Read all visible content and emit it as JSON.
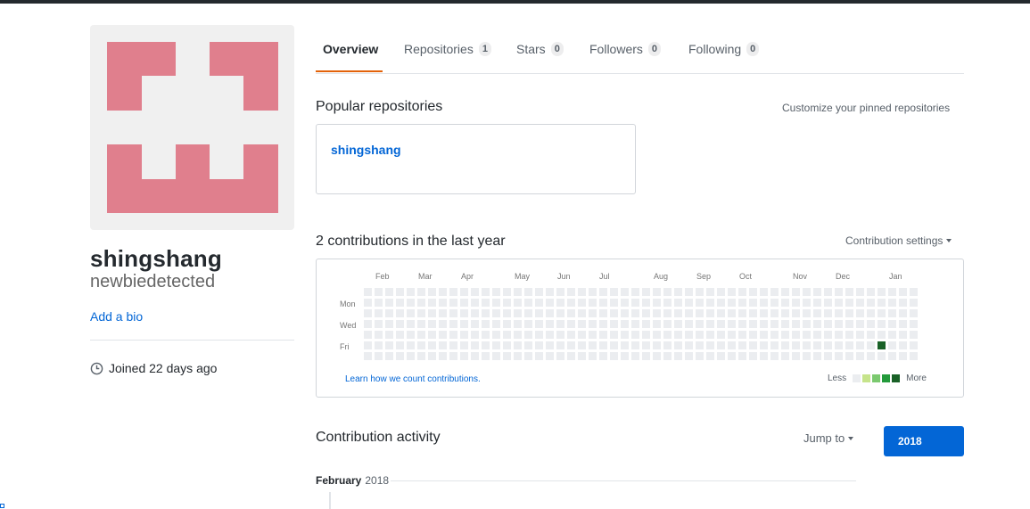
{
  "profile": {
    "full_name": "shingshang",
    "username": "newbiedetected",
    "add_bio": "Add a bio",
    "joined": "Joined 22 days ago",
    "avatar_color": "#e07f8d",
    "avatar_bg": "#f0f0f0"
  },
  "tabs": [
    {
      "label": "Overview",
      "count": null,
      "active": true
    },
    {
      "label": "Repositories",
      "count": "1",
      "active": false
    },
    {
      "label": "Stars",
      "count": "0",
      "active": false
    },
    {
      "label": "Followers",
      "count": "0",
      "active": false
    },
    {
      "label": "Following",
      "count": "0",
      "active": false
    }
  ],
  "popular": {
    "title": "Popular repositories",
    "customize_link": "Customize your pinned repositories",
    "repos": [
      {
        "name": "shingshang"
      }
    ]
  },
  "contributions": {
    "title": "2 contributions in the last year",
    "settings_label": "Contribution settings",
    "months": [
      "Feb",
      "Mar",
      "Apr",
      "May",
      "Jun",
      "Jul",
      "Aug",
      "Sep",
      "Oct",
      "Nov",
      "Dec",
      "Jan"
    ],
    "day_labels": [
      "Mon",
      "Wed",
      "Fri"
    ],
    "learn_link": "Learn how we count contributions.",
    "legend_less": "Less",
    "legend_more": "More",
    "legend_colors": [
      "#ebedf0",
      "#c6e48b",
      "#7bc96f",
      "#239a3b",
      "#196127"
    ],
    "empty_color": "#ebedf0",
    "active_cell": {
      "week": 48,
      "day": 5,
      "color": "#196127"
    },
    "weeks": 52
  },
  "activity": {
    "title": "Contribution activity",
    "jump_to": "Jump to",
    "year_button": "2018",
    "month": "February",
    "year": "2018"
  }
}
